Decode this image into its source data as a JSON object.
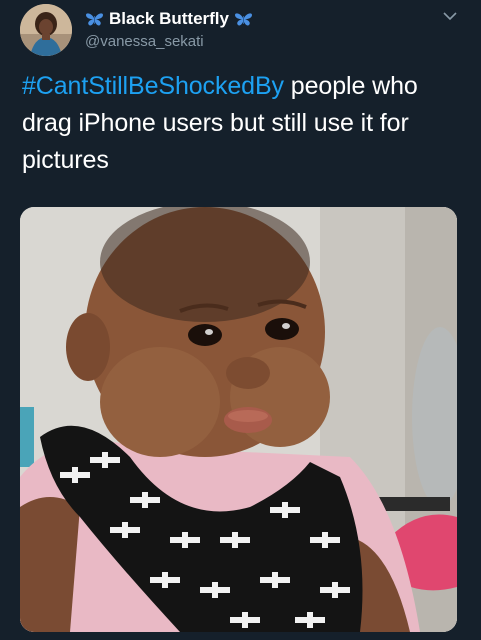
{
  "tweet": {
    "display_name": "Black Butterfly",
    "handle": "@vanessa_sekati",
    "hashtag": "#CantStillBeShockedBy",
    "body": " people who drag iPhone users but still use it for pictures"
  },
  "icons": {
    "butterfly": "butterfly-icon",
    "caret": "chevron-down-icon"
  },
  "colors": {
    "background": "#15202b",
    "hashtag": "#1da1f2",
    "handle": "#8899a6",
    "butterfly": "#4a90e2"
  }
}
